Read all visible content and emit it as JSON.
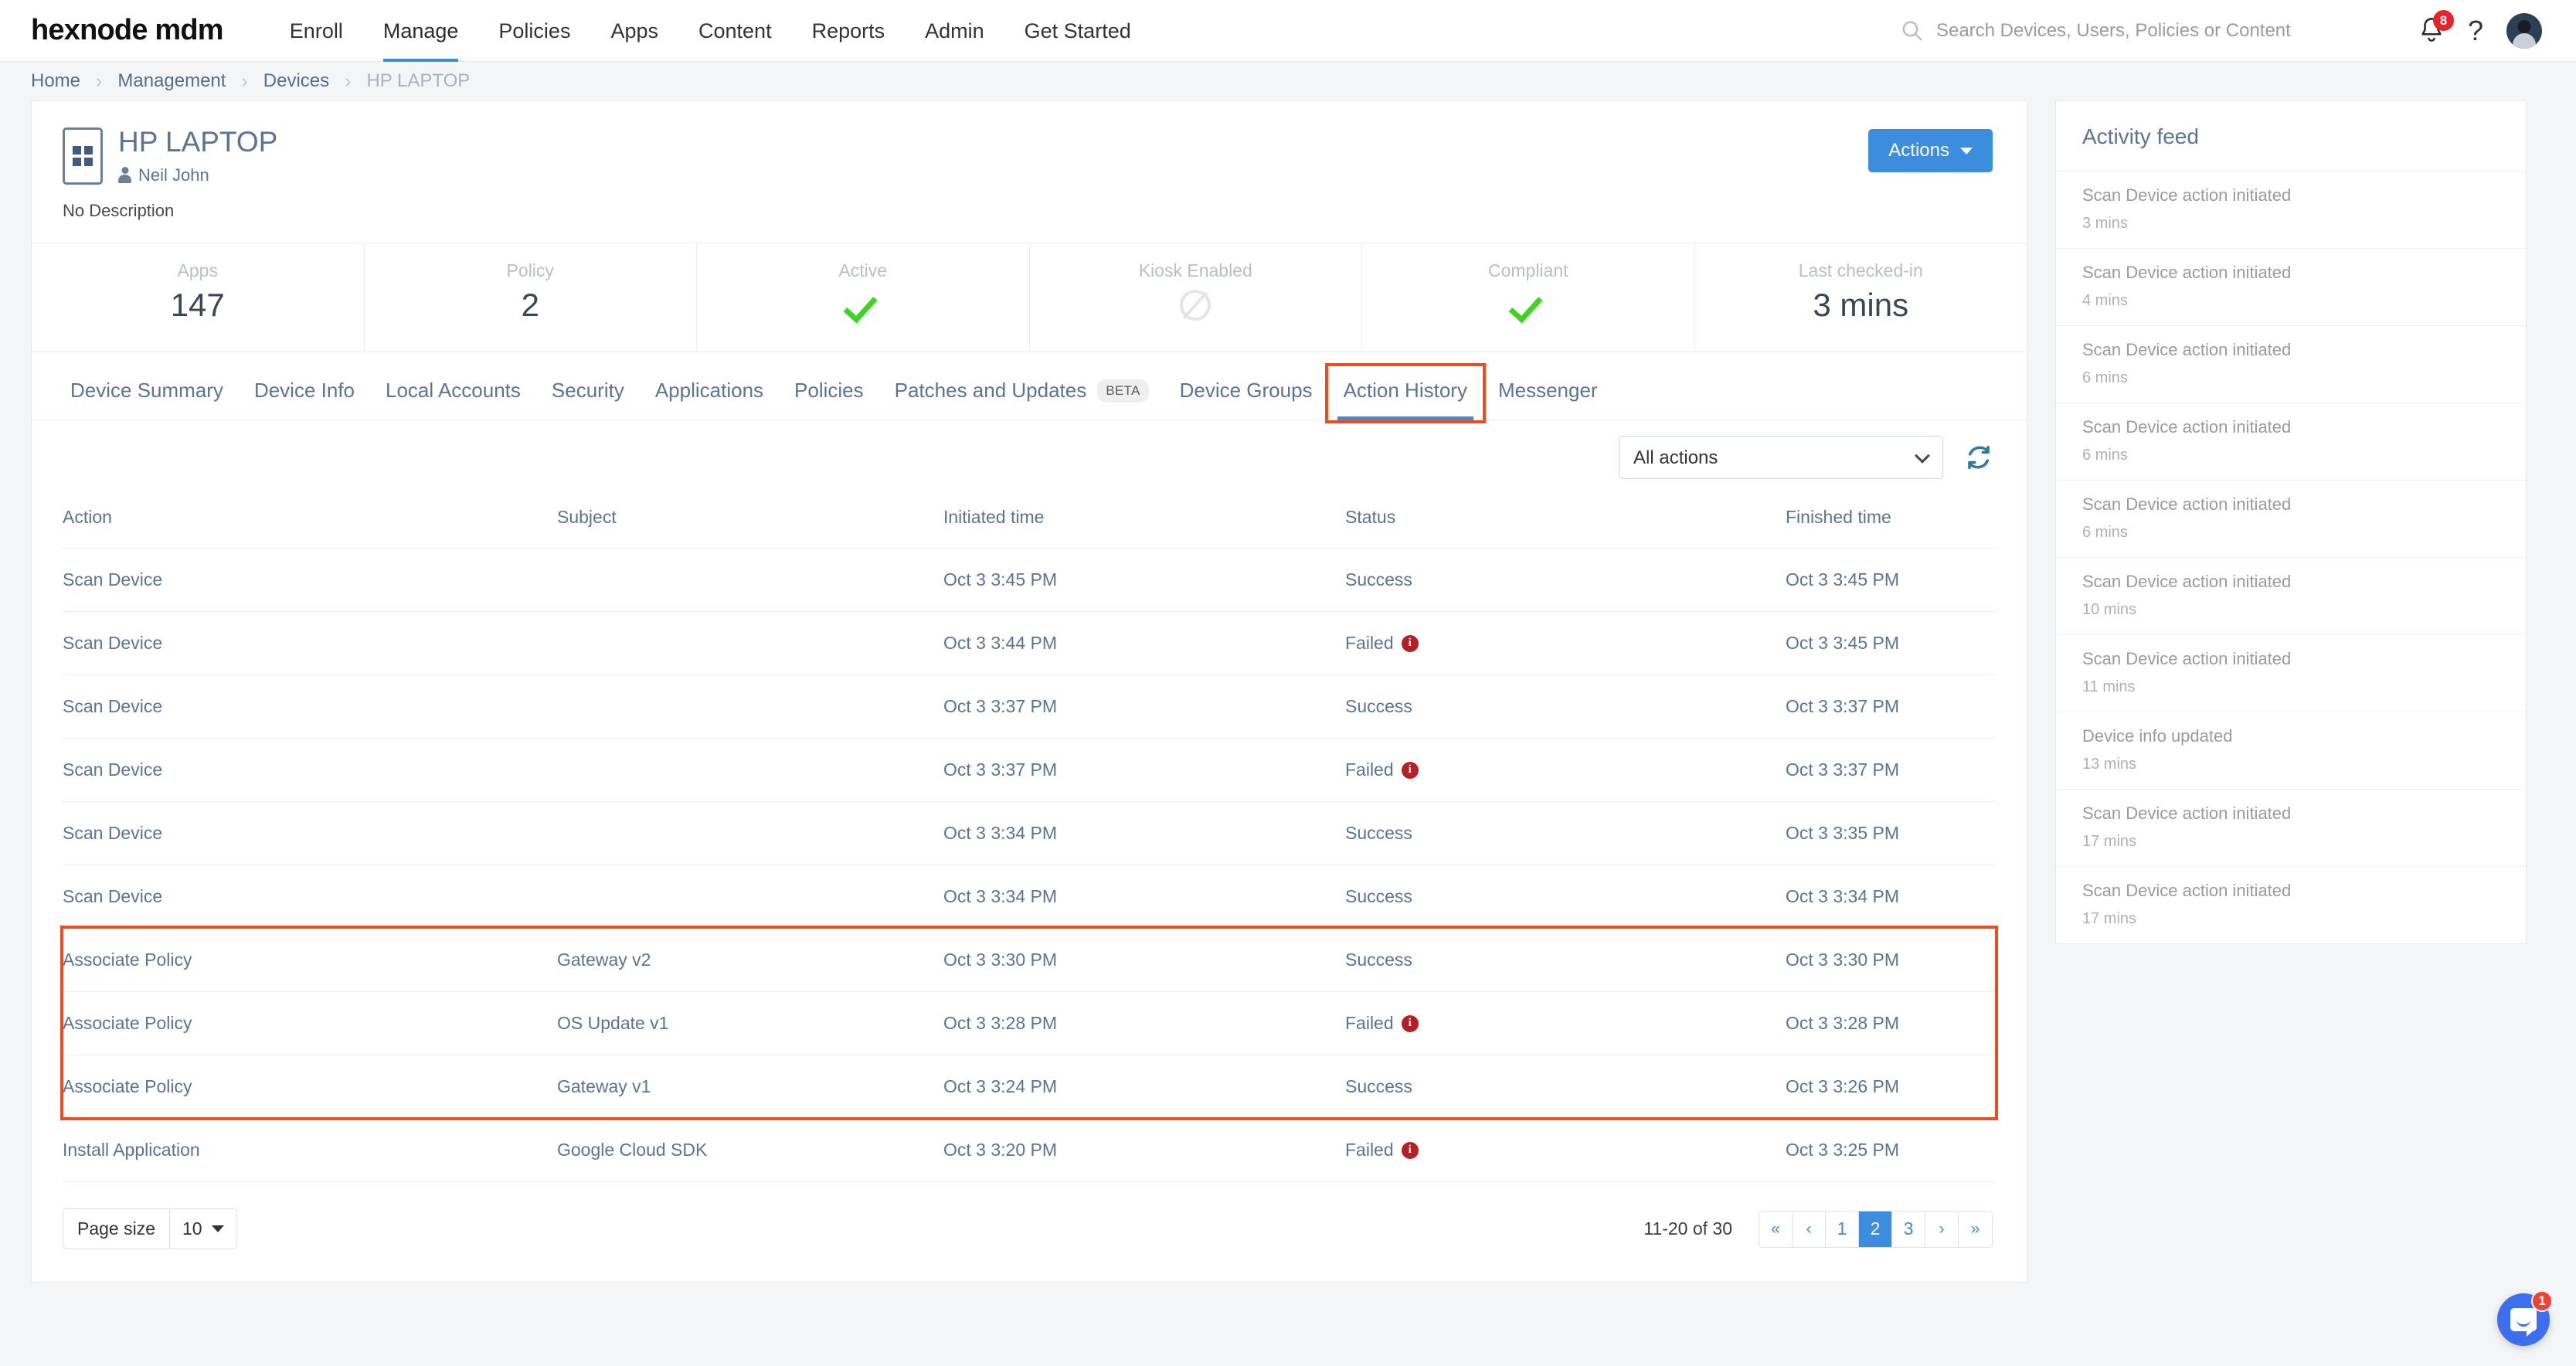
{
  "header": {
    "logo": "hexnode mdm",
    "nav": [
      {
        "label": "Enroll",
        "active": false
      },
      {
        "label": "Manage",
        "active": true
      },
      {
        "label": "Policies",
        "active": false
      },
      {
        "label": "Apps",
        "active": false
      },
      {
        "label": "Content",
        "active": false
      },
      {
        "label": "Reports",
        "active": false
      },
      {
        "label": "Admin",
        "active": false
      },
      {
        "label": "Get Started",
        "active": false
      }
    ],
    "search_placeholder": "Search Devices, Users, Policies or Content",
    "search_value": "",
    "notification_count": "8",
    "help_glyph": "?"
  },
  "breadcrumb": [
    {
      "label": "Home",
      "current": false
    },
    {
      "label": "Management",
      "current": false
    },
    {
      "label": "Devices",
      "current": false
    },
    {
      "label": "HP LAPTOP",
      "current": true
    }
  ],
  "device": {
    "name": "HP LAPTOP",
    "owner": "Neil John",
    "description": "No Description",
    "actions_label": "Actions"
  },
  "stats": [
    {
      "label": "Apps",
      "value": "147",
      "type": "number"
    },
    {
      "label": "Policy",
      "value": "2",
      "type": "number"
    },
    {
      "label": "Active",
      "value": "",
      "type": "check"
    },
    {
      "label": "Kiosk Enabled",
      "value": "",
      "type": "disabled"
    },
    {
      "label": "Compliant",
      "value": "",
      "type": "check"
    },
    {
      "label": "Last checked-in",
      "value": "3 mins",
      "type": "number"
    }
  ],
  "tabs": [
    {
      "label": "Device Summary",
      "active": false,
      "badge": null,
      "highlighted": false
    },
    {
      "label": "Device Info",
      "active": false,
      "badge": null,
      "highlighted": false
    },
    {
      "label": "Local Accounts",
      "active": false,
      "badge": null,
      "highlighted": false
    },
    {
      "label": "Security",
      "active": false,
      "badge": null,
      "highlighted": false
    },
    {
      "label": "Applications",
      "active": false,
      "badge": null,
      "highlighted": false
    },
    {
      "label": "Policies",
      "active": false,
      "badge": null,
      "highlighted": false
    },
    {
      "label": "Patches and Updates",
      "active": false,
      "badge": "BETA",
      "highlighted": false
    },
    {
      "label": "Device Groups",
      "active": false,
      "badge": null,
      "highlighted": false
    },
    {
      "label": "Action History",
      "active": true,
      "badge": null,
      "highlighted": true
    },
    {
      "label": "Messenger",
      "active": false,
      "badge": null,
      "highlighted": false
    }
  ],
  "filter": {
    "selected": "All actions",
    "options": [
      "All actions"
    ],
    "refresh_title": "Refresh"
  },
  "table": {
    "columns": [
      "Action",
      "Subject",
      "Initiated time",
      "Status",
      "Finished time"
    ],
    "rows": [
      {
        "action": "Scan Device",
        "subject": "",
        "initiated": "Oct 3 3:45 PM",
        "status": "Success",
        "failed": false,
        "finished": "Oct 3 3:45 PM",
        "highlighted": false
      },
      {
        "action": "Scan Device",
        "subject": "",
        "initiated": "Oct 3 3:44 PM",
        "status": "Failed",
        "failed": true,
        "finished": "Oct 3 3:45 PM",
        "highlighted": false
      },
      {
        "action": "Scan Device",
        "subject": "",
        "initiated": "Oct 3 3:37 PM",
        "status": "Success",
        "failed": false,
        "finished": "Oct 3 3:37 PM",
        "highlighted": false
      },
      {
        "action": "Scan Device",
        "subject": "",
        "initiated": "Oct 3 3:37 PM",
        "status": "Failed",
        "failed": true,
        "finished": "Oct 3 3:37 PM",
        "highlighted": false
      },
      {
        "action": "Scan Device",
        "subject": "",
        "initiated": "Oct 3 3:34 PM",
        "status": "Success",
        "failed": false,
        "finished": "Oct 3 3:35 PM",
        "highlighted": false
      },
      {
        "action": "Scan Device",
        "subject": "",
        "initiated": "Oct 3 3:34 PM",
        "status": "Success",
        "failed": false,
        "finished": "Oct 3 3:34 PM",
        "highlighted": false
      },
      {
        "action": "Associate Policy",
        "subject": "Gateway v2",
        "initiated": "Oct 3 3:30 PM",
        "status": "Success",
        "failed": false,
        "finished": "Oct 3 3:30 PM",
        "highlighted": true
      },
      {
        "action": "Associate Policy",
        "subject": "OS Update v1",
        "initiated": "Oct 3 3:28 PM",
        "status": "Failed",
        "failed": true,
        "finished": "Oct 3 3:28 PM",
        "highlighted": true
      },
      {
        "action": "Associate Policy",
        "subject": "Gateway v1",
        "initiated": "Oct 3 3:24 PM",
        "status": "Success",
        "failed": false,
        "finished": "Oct 3 3:26 PM",
        "highlighted": true
      },
      {
        "action": "Install Application",
        "subject": "Google Cloud SDK",
        "initiated": "Oct 3 3:20 PM",
        "status": "Failed",
        "failed": true,
        "finished": "Oct 3 3:25 PM",
        "highlighted": false
      }
    ]
  },
  "pagination": {
    "page_size_label": "Page size",
    "page_size_value": "10",
    "range": "11-20 of 30",
    "buttons": [
      {
        "label": "«",
        "active": false,
        "kind": "chev"
      },
      {
        "label": "‹",
        "active": false,
        "kind": "chev"
      },
      {
        "label": "1",
        "active": false,
        "kind": "page"
      },
      {
        "label": "2",
        "active": true,
        "kind": "page"
      },
      {
        "label": "3",
        "active": false,
        "kind": "page"
      },
      {
        "label": "›",
        "active": false,
        "kind": "chev"
      },
      {
        "label": "»",
        "active": false,
        "kind": "chev"
      }
    ]
  },
  "activity_feed": {
    "title": "Activity feed",
    "items": [
      {
        "title": "Scan Device action initiated",
        "time": "3 mins"
      },
      {
        "title": "Scan Device action initiated",
        "time": "4 mins"
      },
      {
        "title": "Scan Device action initiated",
        "time": "6 mins"
      },
      {
        "title": "Scan Device action initiated",
        "time": "6 mins"
      },
      {
        "title": "Scan Device action initiated",
        "time": "6 mins"
      },
      {
        "title": "Scan Device action initiated",
        "time": "10 mins"
      },
      {
        "title": "Scan Device action initiated",
        "time": "11 mins"
      },
      {
        "title": "Device info updated",
        "time": "13 mins"
      },
      {
        "title": "Scan Device action initiated",
        "time": "17 mins"
      },
      {
        "title": "Scan Device action initiated",
        "time": "17 mins"
      }
    ]
  },
  "chat": {
    "badge": "1"
  },
  "colors": {
    "accent": "#3c8dde",
    "highlight": "#f04a1e",
    "success": "#3cd521",
    "danger": "#b52025",
    "heading": "#5b7396"
  }
}
